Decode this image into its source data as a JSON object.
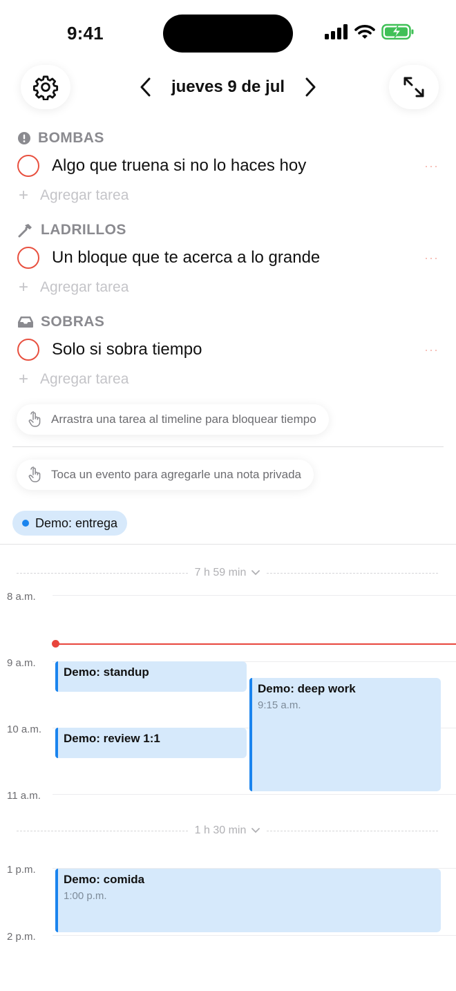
{
  "status_bar": {
    "time": "9:41"
  },
  "header": {
    "date_title": "jueves 9 de jul"
  },
  "sections": [
    {
      "title": "BOMBAS",
      "icon": "exclamation-circle-icon",
      "task": "Algo que truena si no lo haces hoy",
      "more": "···",
      "add_label": "Agregar tarea"
    },
    {
      "title": "LADRILLOS",
      "icon": "hammer-icon",
      "task": "Un bloque que te acerca a lo grande",
      "more": "···",
      "add_label": "Agregar tarea"
    },
    {
      "title": "SOBRAS",
      "icon": "tray-icon",
      "task": "Solo si sobra tiempo",
      "more": "···",
      "add_label": "Agregar tarea"
    }
  ],
  "hints": {
    "drag": "Arrastra una tarea al timeline para bloquear tiempo",
    "tap": "Toca un evento para agregarle una nota privada"
  },
  "all_day_event": {
    "title": "Demo: entrega",
    "color": "#1a84ee"
  },
  "timeline": {
    "gaps": [
      {
        "label": "7 h 59 min"
      },
      {
        "label": "1 h 30 min"
      }
    ],
    "hours": [
      "8 a.m.",
      "9 a.m.",
      "10 a.m.",
      "11 a.m.",
      "1 p.m.",
      "2 p.m."
    ],
    "events": [
      {
        "title": "Demo: standup",
        "time": ""
      },
      {
        "title": "Demo: deep work",
        "time": "9:15 a.m."
      },
      {
        "title": "Demo: review 1:1",
        "time": ""
      },
      {
        "title": "Demo: comida",
        "time": "1:00 p.m."
      }
    ]
  },
  "colors": {
    "accent_red": "#e8503f",
    "event_blue": "#1a84ee",
    "event_bg": "#d6e9fb",
    "now_line": "#e8453c"
  }
}
